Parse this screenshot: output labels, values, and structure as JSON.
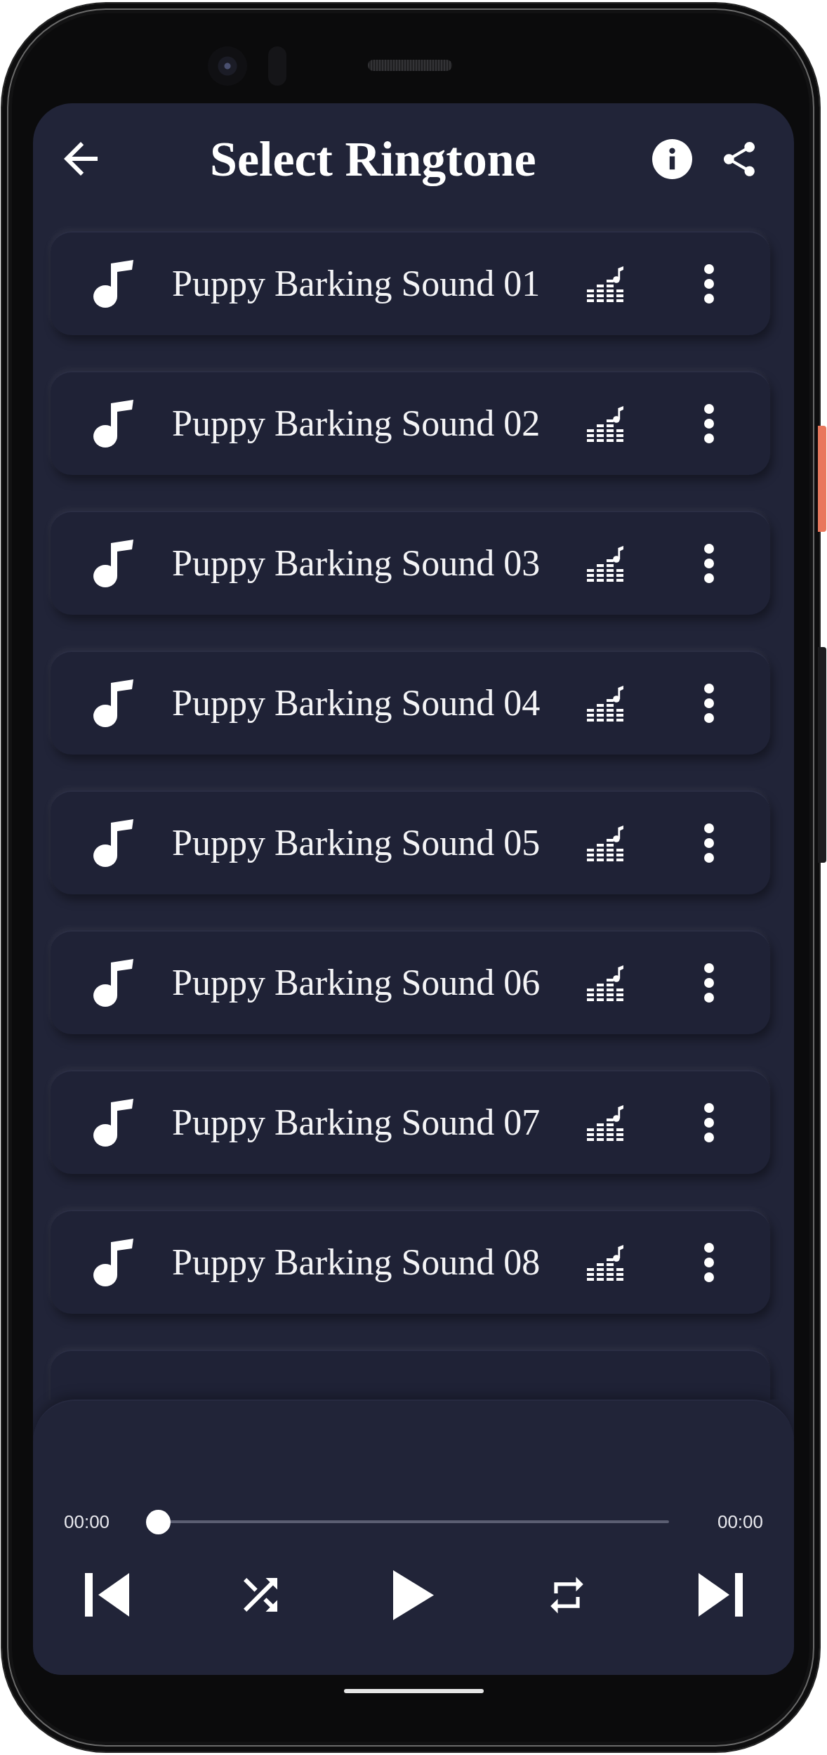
{
  "app_bar": {
    "title": "Select Ringtone"
  },
  "ringtones": [
    {
      "title": "Puppy Barking Sound 01"
    },
    {
      "title": "Puppy Barking Sound 02"
    },
    {
      "title": "Puppy Barking Sound 03"
    },
    {
      "title": "Puppy Barking Sound 04"
    },
    {
      "title": "Puppy Barking Sound 05"
    },
    {
      "title": "Puppy Barking Sound 06"
    },
    {
      "title": "Puppy Barking Sound 07"
    },
    {
      "title": "Puppy Barking Sound 08"
    }
  ],
  "player": {
    "elapsed": "00:00",
    "duration": "00:00",
    "seek": {
      "level": 0
    }
  }
}
